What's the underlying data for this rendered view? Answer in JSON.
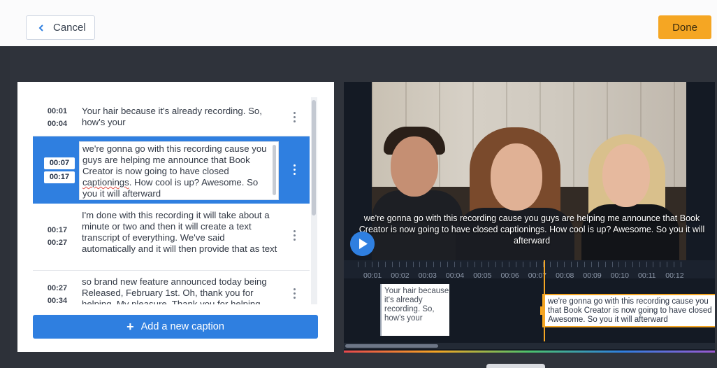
{
  "header": {
    "cancel_label": "Cancel",
    "done_label": "Done"
  },
  "captions": [
    {
      "start": "00:01",
      "end": "00:04",
      "text": "Your hair because it's already recording. So, how's your"
    },
    {
      "start": "00:07",
      "end": "00:17",
      "text_before": "we're gonna go with this recording cause you guys are helping me announce that Book Creator is now going to have closed ",
      "text_misspelled": "captionings",
      "text_after": ". How cool is up? Awesome. So you it will afterward",
      "active": true
    },
    {
      "start": "00:17",
      "end": "00:27",
      "text": "I'm done with this recording it will take about a minute or two and then it will create a text transcript of everything. We've said automatically and it will then provide that as text"
    },
    {
      "start": "00:27",
      "end": "00:34",
      "text": "so brand new feature announced today being Released, February 1st. Oh, thank you for helping. My pleasure. Thank you for helping"
    }
  ],
  "add_caption_label": "Add a new caption",
  "video": {
    "subtitle": "we're gonna go with this recording cause you guys are helping me announce that Book Creator is now going to have closed captionings. How cool is up? Awesome. So you it will afterward"
  },
  "timeline": {
    "ticks": [
      "00:01",
      "00:02",
      "00:03",
      "00:04",
      "00:05",
      "00:06",
      "00:07",
      "00:08",
      "00:09",
      "00:10",
      "00:11",
      "00:12"
    ],
    "clips": [
      {
        "text": "Your hair because it's already recording. So, how's your"
      },
      {
        "line1": "we're gonna go with this recording cause you",
        "line2": "that Book Creator is now going to have closed",
        "line3": "Awesome. So you it will afterward"
      }
    ]
  },
  "colors": {
    "accent_blue": "#2f7fe0",
    "done_orange": "#f5a623",
    "dark_bg": "#2f333b"
  }
}
